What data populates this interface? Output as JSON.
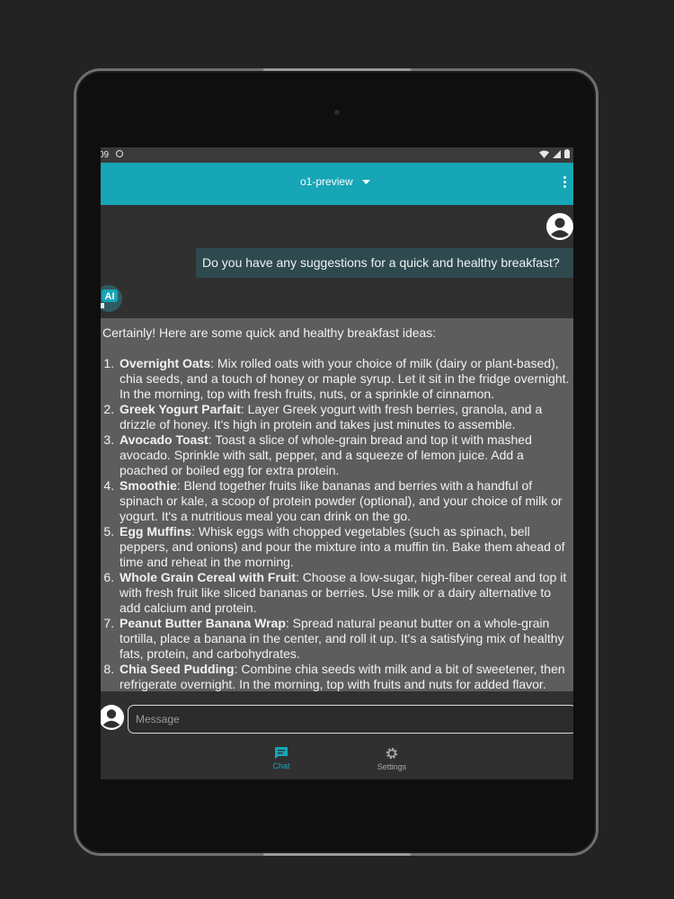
{
  "status_bar": {
    "time": "09"
  },
  "app_bar": {
    "model": "o1-preview"
  },
  "chat": {
    "user_message": "Do you have any suggestions for a quick and healthy breakfast?",
    "ai_avatar_label": "AI",
    "ai_intro": "Certainly! Here are some quick and healthy breakfast ideas:",
    "ai_items": [
      {
        "title": "Overnight Oats",
        "text": ": Mix rolled oats with your choice of milk (dairy or plant-based), chia seeds, and a touch of honey or maple syrup. Let it sit in the fridge overnight. In the morning, top with fresh fruits, nuts, or a sprinkle of cinnamon."
      },
      {
        "title": "Greek Yogurt Parfait",
        "text": ": Layer Greek yogurt with fresh berries, granola, and a drizzle of honey. It's high in protein and takes just minutes to assemble."
      },
      {
        "title": "Avocado Toast",
        "text": ": Toast a slice of whole-grain bread and top it with mashed avocado. Sprinkle with salt, pepper, and a squeeze of lemon juice. Add a poached or boiled egg for extra protein."
      },
      {
        "title": "Smoothie",
        "text": ": Blend together fruits like bananas and berries with a handful of spinach or kale, a scoop of protein powder (optional), and your choice of milk or yogurt. It's a nutritious meal you can drink on the go."
      },
      {
        "title": "Egg Muffins",
        "text": ": Whisk eggs with chopped vegetables (such as spinach, bell peppers, and onions) and pour the mixture into a muffin tin. Bake them ahead of time and reheat in the morning."
      },
      {
        "title": "Whole Grain Cereal with Fruit",
        "text": ": Choose a low-sugar, high-fiber cereal and top it with fresh fruit like sliced bananas or berries. Use milk or a dairy alternative to add calcium and protein."
      },
      {
        "title": "Peanut Butter Banana Wrap",
        "text": ": Spread natural peanut butter on a whole-grain tortilla, place a banana in the center, and roll it up. It's a satisfying mix of healthy fats, protein, and carbohydrates."
      },
      {
        "title": "Chia Seed Pudding",
        "text": ": Combine chia seeds with milk and a bit of sweetener, then refrigerate overnight. In the morning, top with fruits and nuts for added flavor."
      }
    ]
  },
  "input": {
    "placeholder": "Message",
    "value": ""
  },
  "bottom_nav": {
    "chat_label": "Chat",
    "settings_label": "Settings"
  },
  "colors": {
    "accent": "#16a6b6",
    "background": "#303030",
    "user_bubble": "#2f4a4f",
    "ai_bubble": "#5d5d5d"
  }
}
